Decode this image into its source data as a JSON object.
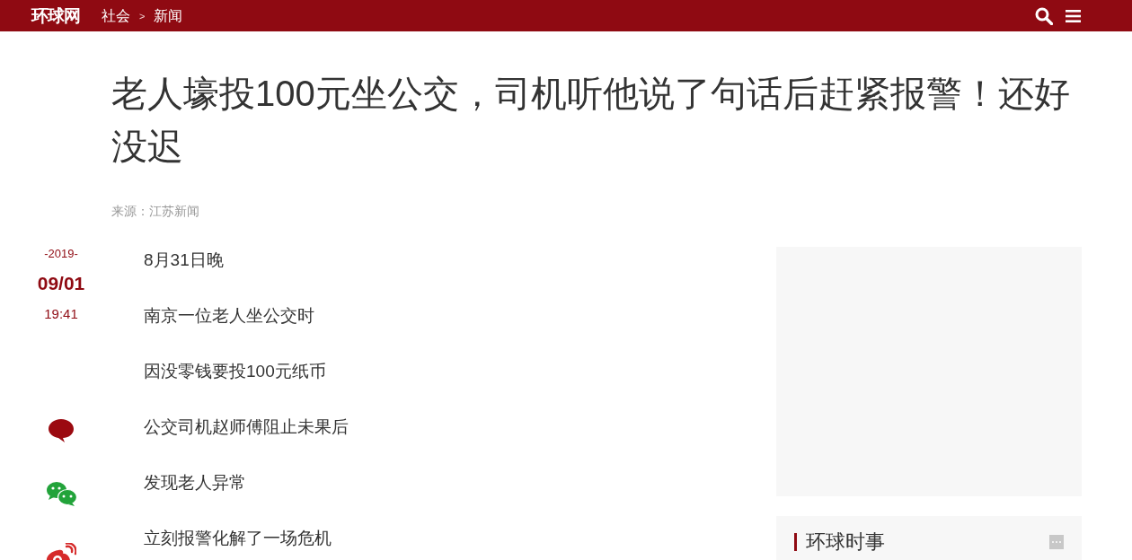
{
  "header": {
    "logo": "环球网",
    "breadcrumb": {
      "items": [
        "社会",
        "新闻"
      ],
      "separator": ">"
    }
  },
  "article": {
    "title": "老人壕投100元坐公交，司机听他说了句话后赶紧报警！还好没迟",
    "source": "来源：江苏新闻",
    "date": {
      "year": "-2019-",
      "day": "09/01",
      "time": "19:41"
    },
    "paragraphs": [
      "8月31日晚",
      "南京一位老人坐公交时",
      "因没零钱要投100元纸币",
      "公交司机赵师傅阻止未果后",
      "发现老人异常",
      "立刻报警化解了一场危机"
    ]
  },
  "share": [
    {
      "kind": "comment"
    },
    {
      "kind": "wechat"
    },
    {
      "kind": "weibo"
    }
  ],
  "sidebar": {
    "panel": {
      "title": "环球时事"
    }
  }
}
